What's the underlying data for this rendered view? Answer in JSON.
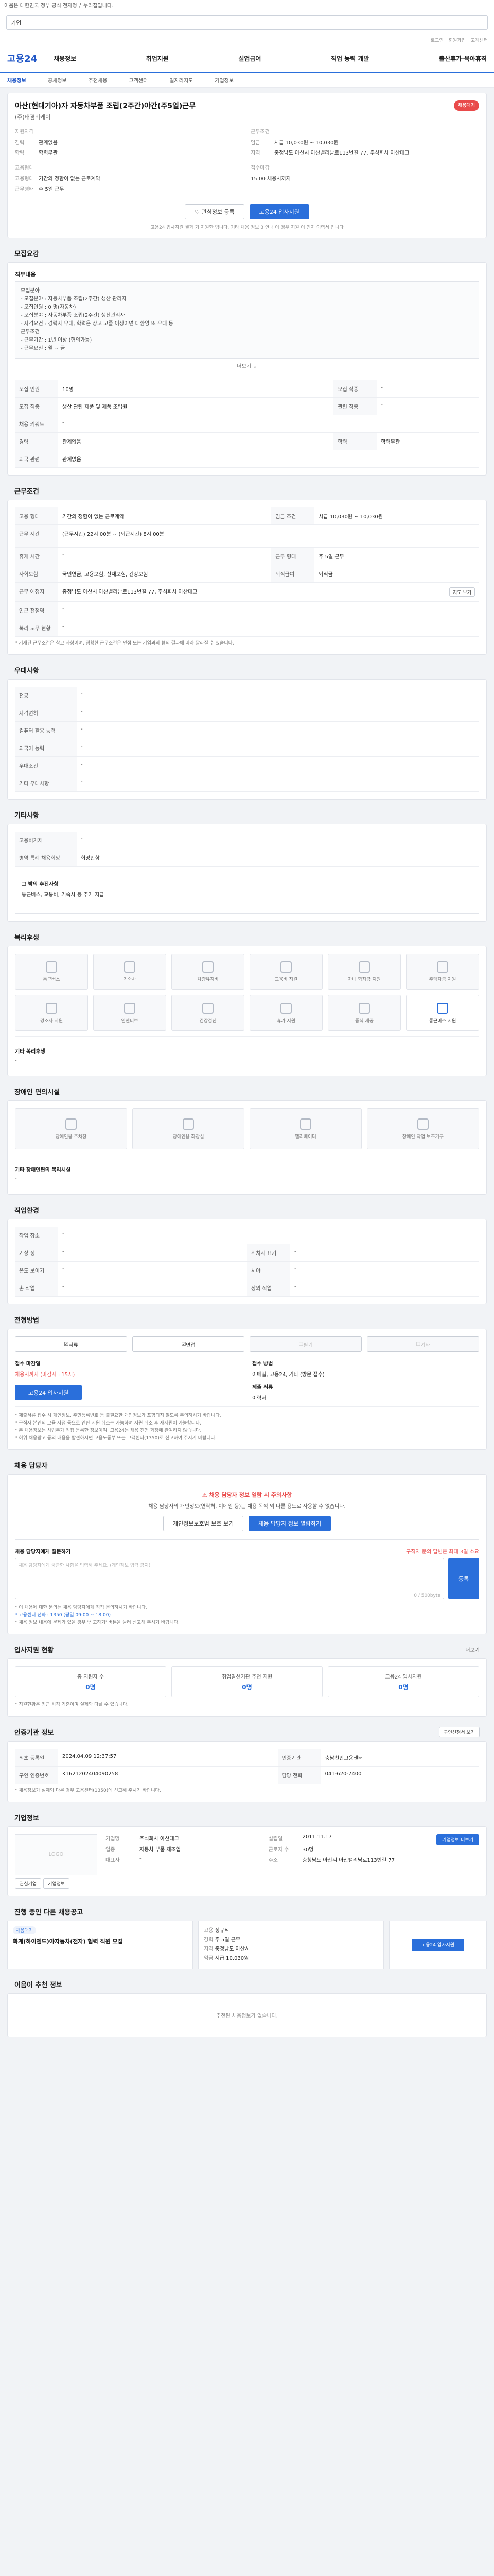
{
  "topbar": {
    "notice": "이음은 대한민국 정부 공식 전자정부 누리집입니다."
  },
  "search": {
    "query": "기업"
  },
  "util": {
    "links": [
      "로그인",
      "회원가입",
      "고객센터"
    ]
  },
  "gnb": {
    "logo": "고용24",
    "menu": [
      "채용정보",
      "취업지원",
      "실업급여",
      "직업 능력 개발",
      "출산휴가·육아휴직"
    ]
  },
  "subnav": {
    "items": [
      "채용정보",
      "공채정보",
      "추천채용",
      "고객센터",
      "일자리지도",
      "기업정보"
    ],
    "active_index": 0
  },
  "job": {
    "title": "아산(현대기아)자 자동차부품 조립(2주간)야간(주5일)근무",
    "badge": "채용대기",
    "company": "(주)태경비케이",
    "qual_header": "지원자격",
    "qual": [
      {
        "k": "경력",
        "v": "관계없음"
      },
      {
        "k": "학력",
        "v": "학력무관"
      }
    ],
    "cond_header": "근무조건",
    "cond": [
      {
        "k": "임금",
        "v": "시급 10,030원 ~ 10,030원"
      },
      {
        "k": "지역",
        "v": "충청남도 아산시 아산밸리남로113번길 77, 주식회사 아산테크"
      }
    ],
    "type_header": "고용형태",
    "type": [
      {
        "k": "고용형태",
        "v": "기간의 정함이 없는 근로계약"
      },
      {
        "k": "근무형태",
        "v": "주 5일 근무"
      }
    ],
    "period_header": "접수마감",
    "period": [
      {
        "k": "",
        "v": "15:00 채용시까지"
      }
    ],
    "btn_scrap": "관심정보 등록",
    "btn_apply": "고용24 입사지원",
    "note": "고용24 입사지원 결과 기 지원한 입니다. 기타 채용 정보 3 안내 이 경우 지원 이 인지 이력서 입니다"
  },
  "desc": {
    "title": "모집요강",
    "header": "직무내용",
    "lines": [
      "모집분야",
      "- 모집분야 : 자동차부품 조립(2주간) 생산 관리자",
      "- 모집인원 : 0 명(자동차) ",
      "- 모집분야 : 자동차부품 조립(2주간) 생산관리자",
      "- 자격요건 : 경력자 우대, 학력은 상고 고졸 이상이면 대환영 또 우대 등",
      "근무조건",
      "- 근무기간 : 1년 이상 (협의가능)",
      "- 근무요일 : 월 ~ 금"
    ],
    "more": "더보기"
  },
  "detail_rows": [
    [
      {
        "k": "모집 인원",
        "v": "10명"
      },
      {
        "k": "모집 직종",
        "v": "-"
      }
    ],
    [
      {
        "k": "모집 직종",
        "v": "생산 관련 제품 및 제품 조립원"
      },
      {
        "k": "관련 직종",
        "v": "-"
      }
    ],
    [
      {
        "k": "채용 키워드",
        "v": "-"
      },
      {
        "k": "",
        "v": ""
      }
    ],
    [
      {
        "k": "경력",
        "v": "관계없음"
      },
      {
        "k": "학력",
        "v": "학력무관"
      }
    ],
    [
      {
        "k": "외국 관련",
        "v": "관계없음"
      },
      {
        "k": "",
        "v": ""
      }
    ]
  ],
  "work": {
    "title": "근무조건",
    "rows": [
      [
        {
          "k": "고용 형태",
          "v": "기간의 정함이 없는 근로계약"
        },
        {
          "k": "임금 조건",
          "v": "시급 10,030원 ~ 10,030원"
        }
      ],
      [
        {
          "k": "근무 시간",
          "v": "(근무시간) 22시 00분 ~ (퇴근시간) 8시 00분"
        },
        {
          "k": "",
          "v": ""
        }
      ],
      [
        {
          "k": "휴게 시간",
          "v": "-"
        },
        {
          "k": "근무 형태",
          "v": "주 5일 근무"
        }
      ],
      [
        {
          "k": "사회보험",
          "v": "국민연금, 고용보험, 산재보험, 건강보험"
        },
        {
          "k": "퇴직급여",
          "v": "퇴직금"
        }
      ],
      [
        {
          "k": "근무 예정지",
          "v": "충청남도 아산시 아산밸리남로113번길 77, 주식회사 아산테크"
        },
        {
          "k": "",
          "v": ""
        }
      ],
      [
        {
          "k": "인근 전철역",
          "v": "-"
        },
        {
          "k": "",
          "v": ""
        }
      ],
      [
        {
          "k": "복리 노무 현황",
          "v": "-"
        },
        {
          "k": "",
          "v": ""
        }
      ]
    ],
    "map_btn": "지도 보기",
    "footnote": "* 기재된 근무조건은 참고 사항이며, 정확한 근무조건은 면접 또는 기업과의 협의 결과에 따라 달라질 수 있습니다."
  },
  "prefer": {
    "title": "우대사항",
    "rows": [
      {
        "k": "전공",
        "v": "-"
      },
      {
        "k": "자격면허",
        "v": "-"
      },
      {
        "k": "컴퓨터 활용 능력",
        "v": "-"
      },
      {
        "k": "외국어 능력",
        "v": "-"
      },
      {
        "k": "우대조건",
        "v": "-"
      },
      {
        "k": "기타 우대사항",
        "v": "-"
      }
    ]
  },
  "etc": {
    "title": "기타사항",
    "rows": [
      {
        "k": "고용허가제",
        "v": "-"
      },
      {
        "k": "병역 특례 채용희망",
        "v": "희망안함"
      }
    ],
    "box_title": "그 밖의 추진사항",
    "box_text": "통근버스, 교통비, 기숙사 등 추가 지급"
  },
  "welfare": {
    "title": "복리후생",
    "items": [
      "통근버스",
      "기숙사",
      "차량유지비",
      "교육비 지원",
      "자녀 학자금 지원",
      "주택자금 지원",
      "경조사 지원",
      "인센티브",
      "건강검진",
      "휴가 지원",
      "중식 제공",
      "통근버스 지원"
    ],
    "active_index": 11,
    "etc_label": "기타 복리후생",
    "etc_value": "-"
  },
  "disabled": {
    "title": "장애인 편의시설",
    "items": [
      "장애인용 주차장",
      "장애인용 화장실",
      "엘리베이터",
      "장애인 작업 보조기구"
    ],
    "etc_label": "기타 장애인편의 복리시설",
    "etc_value": "-"
  },
  "workplace": {
    "title": "직업환경",
    "rows": [
      [
        {
          "k": "작업 장소",
          "v": "-"
        },
        {
          "k": "",
          "v": ""
        }
      ],
      [
        {
          "k": "기상 정",
          "v": "-"
        },
        {
          "k": "위치시 표기",
          "v": "-"
        }
      ],
      [
        {
          "k": "온도 보이기",
          "v": "-"
        },
        {
          "k": "시야",
          "v": "-"
        }
      ],
      [
        {
          "k": "손 작업",
          "v": "-"
        },
        {
          "k": "장의 작업",
          "v": "-"
        }
      ]
    ]
  },
  "selection": {
    "title": "전형방법",
    "methods": [
      "서류",
      "면접",
      "필기",
      "기타"
    ],
    "methods_active": [
      true,
      true,
      false,
      false
    ],
    "deadline_label": "접수 마감일",
    "deadline_value": "채용시까지 (마감시 : 15시)",
    "method_label": "접수 방법",
    "method_value": "이메일, 고용24, 기타 (방문 접수)",
    "docs_label": "제출 서류",
    "docs_value": "이력서",
    "apply_btn": "고용24 입사지원",
    "notices": [
      "* 제출서류 접수 시 개인정보, 주민등록번호 등 불필요한 개인정보가 포함되지 않도록 주의하시기 바랍니다.",
      "* 구직자 본인의 고용 사정 등으로 인한 지원 취소는 가능하며 지원 취소 후 재지원이 가능합니다.",
      "* 본 채용정보는 사업주가 직접 등록한 정보이며, 고용24는 채용 진행 과정에 관여하지 않습니다.",
      "* 허위 채용광고 등의 내용을 발견하시면 고용노동부 또는 고객센터(1350)로 신고하여 주시기 바랍니다."
    ]
  },
  "contact": {
    "title": "채용 담당자",
    "alert_title": "채용 담당자 정보 열람 시 주의사항",
    "alert_text": "채용 담당자의 개인정보(연락처, 이메일 등)는 채용 목적 외 다른 용도로 사용할 수 없습니다.",
    "btn_a": "개인정보보호법 보호 보기",
    "btn_b": "채용 담당자 정보 열람하기",
    "q_title": "채용 담당자에게 질문하기",
    "q_hint": "구직자 문의 답변은 최대 3일 소요",
    "q_placeholder": "채용 담당자에게 궁금한 사항을 입력해 주세요. (개인정보 입력 금지)",
    "q_counter": "0 / 500byte",
    "q_btn": "등록",
    "notes": [
      "* 이 채용에 대한 문의는 채용 담당자에게 직접 문의하시기 바랍니다.",
      "* 고용센터 전화 : 1350 (평일 09:00 ~ 18:00)",
      "* 채용 정보 내용에 문제가 있을 경우 '신고하기' 버튼을 눌러 신고해 주시기 바랍니다."
    ]
  },
  "status": {
    "title": "입사지원 현황",
    "link": "더보기",
    "items": [
      {
        "label": "총 지원자 수",
        "value": "0명"
      },
      {
        "label": "취업알선기관 추천 지원",
        "value": "0명"
      },
      {
        "label": "고용24 입사지원",
        "value": "0명"
      }
    ],
    "note": "* 지원현황은 최근 시점 기준이며 실제와 다를 수 있습니다."
  },
  "reginfo": {
    "title": "인증기관 정보",
    "btn": "구인신청서 보기",
    "rows": [
      [
        {
          "k": "최초 등록일",
          "v": "2024.04.09 12:37:57"
        },
        {
          "k": "인증기관",
          "v": "충남천안고용센터"
        }
      ],
      [
        {
          "k": "구인 인증번호",
          "v": "K1621202404090258"
        },
        {
          "k": "담당 전화",
          "v": "041-620-7400"
        }
      ]
    ],
    "notice": "* 채용정보가 실제와 다른 경우 고용센터(1350)에 신고해 주시기 바랍니다."
  },
  "companyinfo": {
    "title": "기업정보",
    "logo": "LOGO",
    "btn_a": "관심기업",
    "btn_b": "기업정보",
    "k1": "기업명",
    "v1": "주식회사 아산테크",
    "k2": "업종",
    "v2": "자동차 부품 제조업",
    "k3": "대표자",
    "v3": "-",
    "k4": "설립일",
    "v4": "2011.11.17",
    "k5": "근로자 수",
    "v5": "30명",
    "k6": "주소",
    "v6": "충청남도 아산시 아산밸리남로113번길 77",
    "more": "기업정보 더보기"
  },
  "other": {
    "title": "진행 중인 다른 채용공고",
    "tag": "채용대기",
    "job": "화계(하이엔드)야자동차(전자) 협력 직원 모집",
    "k1": "고용",
    "v1": "정규직",
    "k2": "경력",
    "v2": "주 5일 근무",
    "k3": "지역",
    "v3": "충청남도 아산시",
    "k4": "임금",
    "v4": "시급 10,030원",
    "btn": "고용24 입사지원"
  },
  "recommend": {
    "title": "이음이 추천 정보",
    "empty": "추천된 채용정보가 없습니다."
  }
}
